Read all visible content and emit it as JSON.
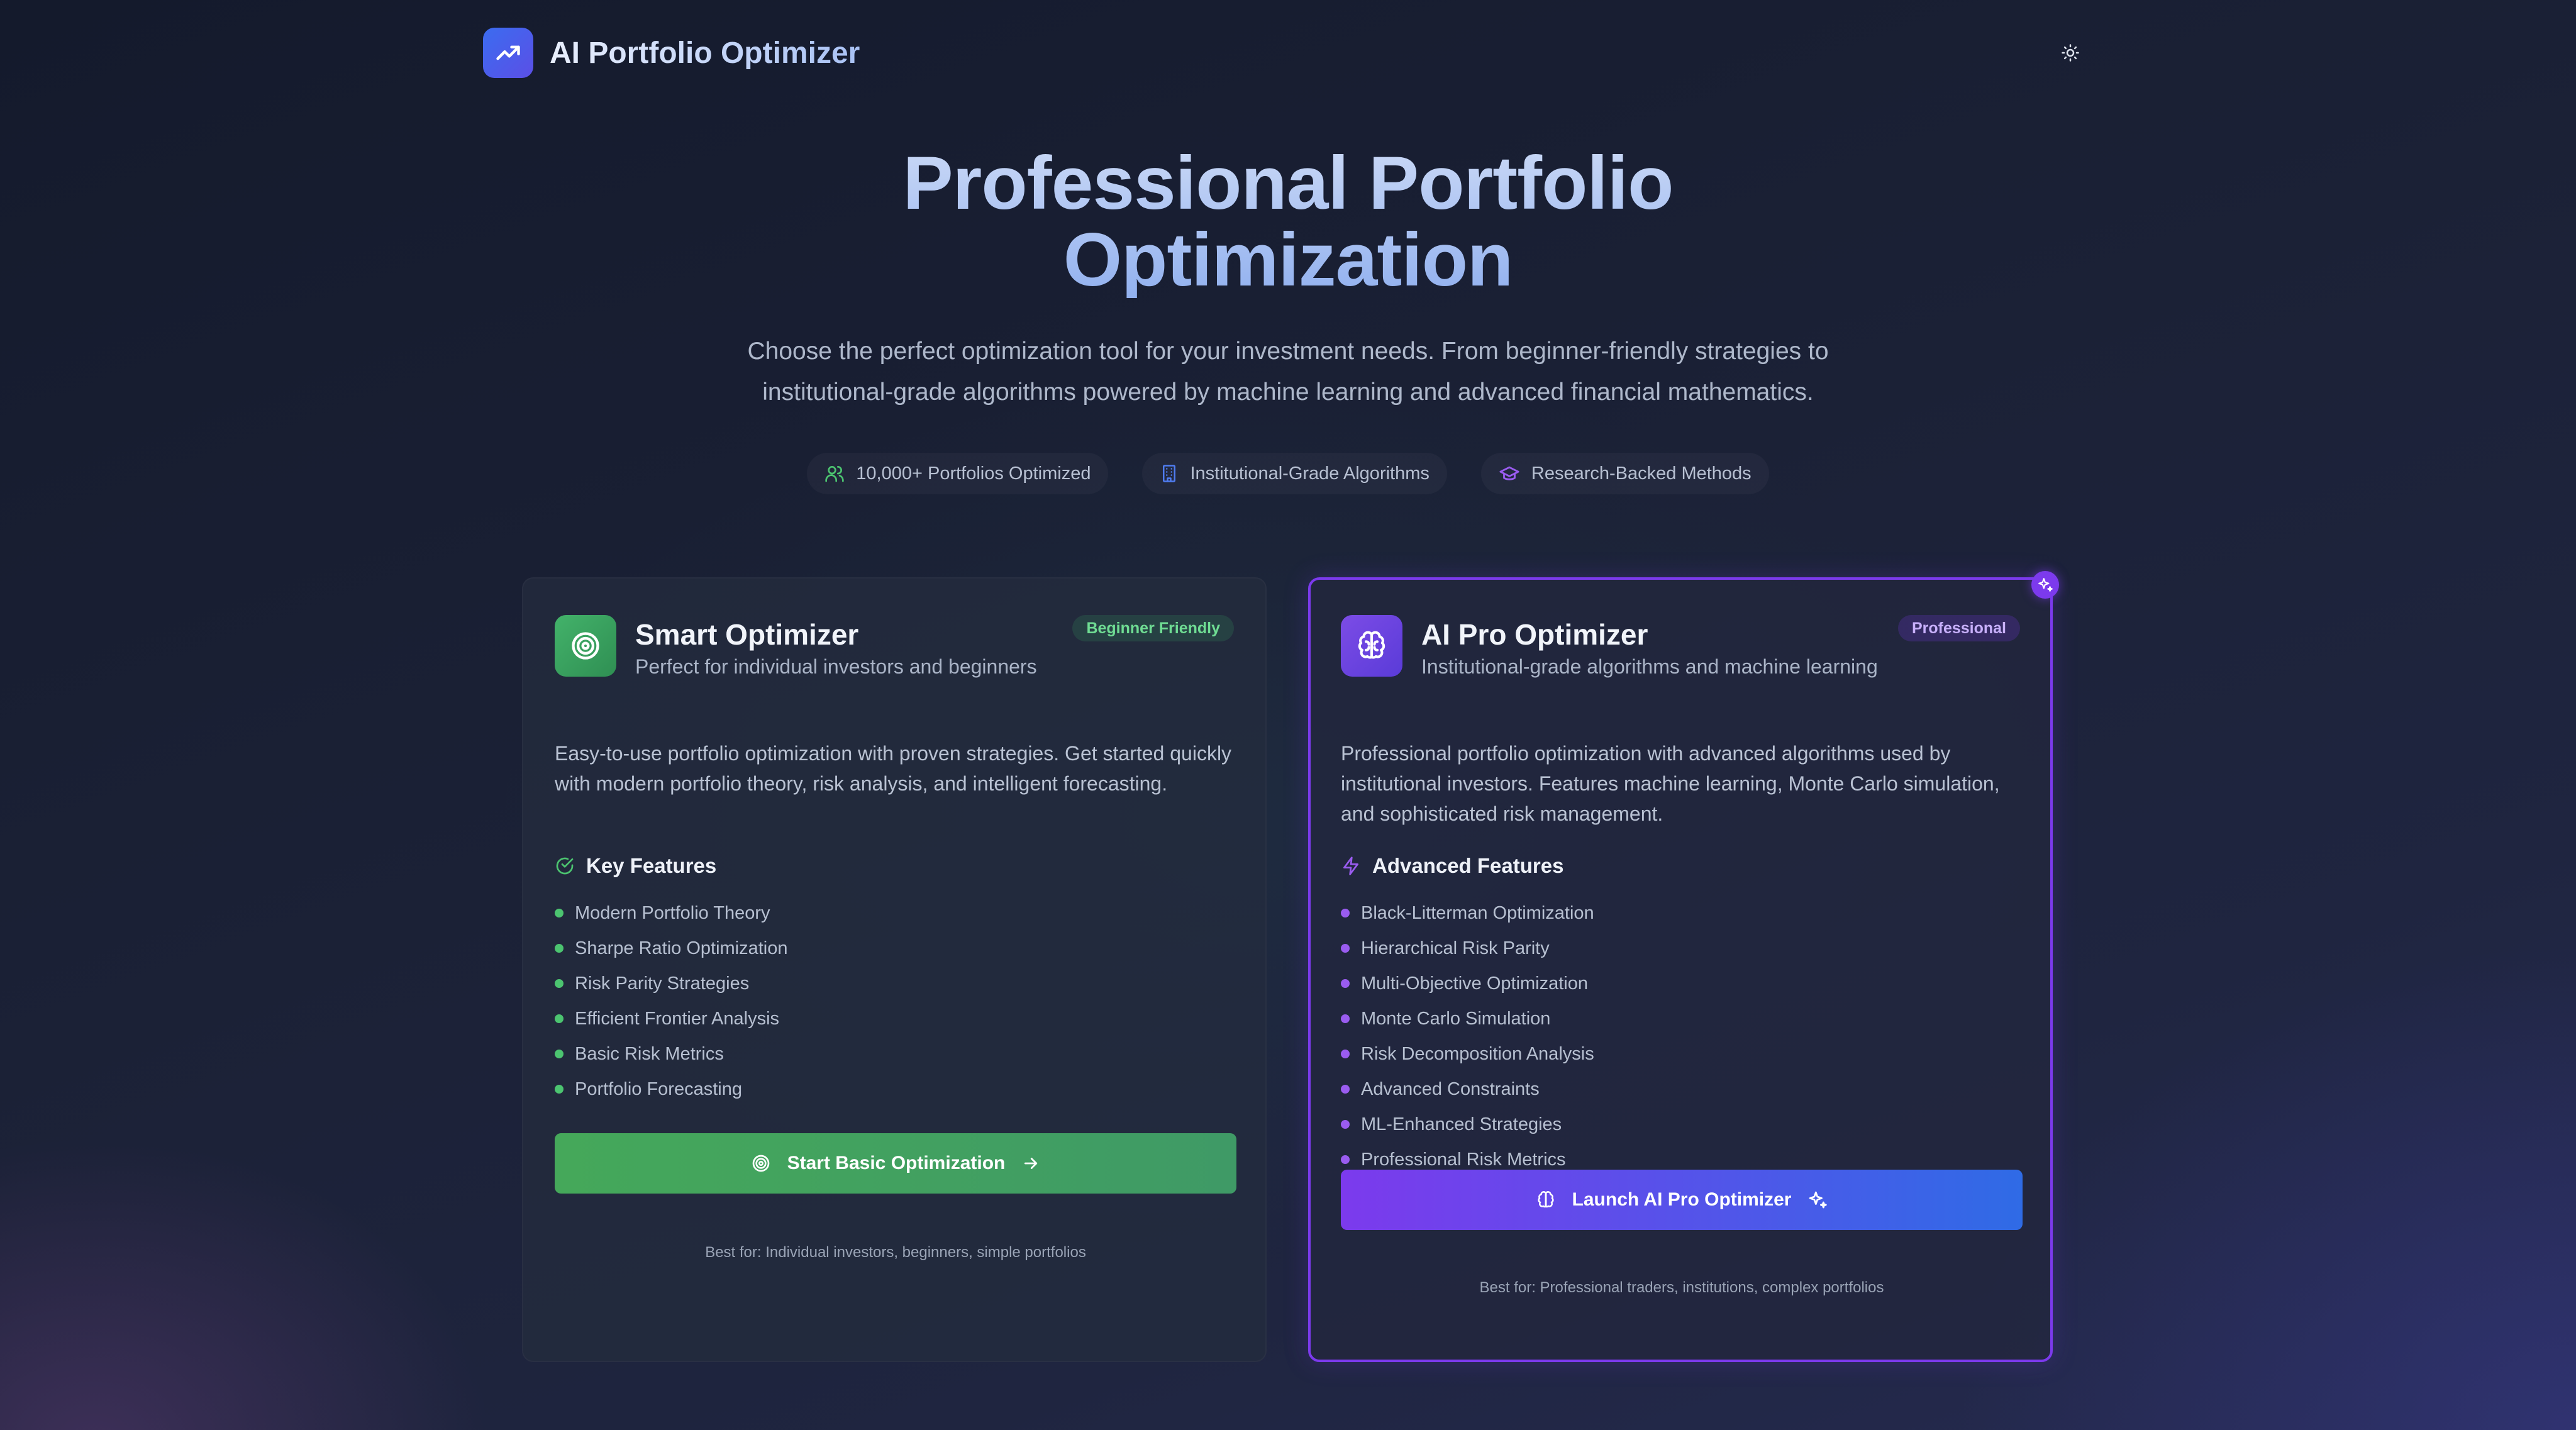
{
  "header": {
    "title": "AI Portfolio Optimizer",
    "logo_icon": "trending-up-icon",
    "theme_toggle_icon": "sun-icon"
  },
  "hero": {
    "title_line1": "Professional Portfolio",
    "title_line2": "Optimization",
    "subtitle_line1": "Choose the perfect optimization tool for your investment needs. From beginner-friendly strategies to",
    "subtitle_line2": "institutional-grade algorithms powered by machine learning and advanced financial mathematics."
  },
  "stats": [
    {
      "icon": "users-icon",
      "label": "10,000+ Portfolios Optimized",
      "color": "#4cc470"
    },
    {
      "icon": "building-icon",
      "label": "Institutional-Grade Algorithms",
      "color": "#4f7cf0"
    },
    {
      "icon": "graduation-cap-icon",
      "label": "Research-Backed Methods",
      "color": "#9a5cf0"
    }
  ],
  "smart_card": {
    "title": "Smart Optimizer",
    "subtitle": "Perfect for individual investors and beginners",
    "badge": "Beginner Friendly",
    "icon": "target-icon",
    "description": "Easy-to-use portfolio optimization with proven strategies. Get started quickly with modern portfolio theory, risk analysis, and intelligent forecasting.",
    "features_heading": "Key Features",
    "features": [
      "Modern Portfolio Theory",
      "Sharpe Ratio Optimization",
      "Risk Parity Strategies",
      "Efficient Frontier Analysis",
      "Basic Risk Metrics",
      "Portfolio Forecasting"
    ],
    "cta_label": "Start Basic Optimization",
    "best_for": "Best for: Individual investors, beginners, simple portfolios",
    "accent": "#4cc470"
  },
  "pro_card": {
    "title": "AI Pro Optimizer",
    "subtitle": "Institutional-grade algorithms and machine learning",
    "badge": "Professional",
    "icon": "brain-icon",
    "description": "Professional portfolio optimization with advanced algorithms used by institutional investors. Features machine learning, Monte Carlo simulation, and sophisticated risk management.",
    "features_heading": "Advanced Features",
    "features": [
      "Black-Litterman Optimization",
      "Hierarchical Risk Parity",
      "Multi-Objective Optimization",
      "Monte Carlo Simulation",
      "Risk Decomposition Analysis",
      "Advanced Constraints",
      "ML-Enhanced Strategies",
      "Professional Risk Metrics"
    ],
    "cta_label": "Launch AI Pro Optimizer",
    "best_for": "Best for: Professional traders, institutions, complex portfolios",
    "accent": "#7c3aed"
  }
}
